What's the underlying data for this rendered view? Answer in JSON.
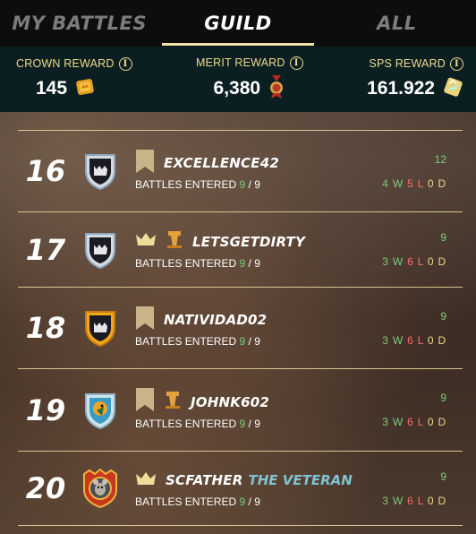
{
  "tabs": [
    {
      "label": "MY BATTLES",
      "active": false
    },
    {
      "label": "GUILD",
      "active": true
    },
    {
      "label": "ALL",
      "active": false
    }
  ],
  "rewards": {
    "crown": {
      "label": "CROWN REWARD",
      "value": "145",
      "icon": "crown-token-icon"
    },
    "merit": {
      "label": "MERIT REWARD",
      "value": "6,380",
      "icon": "merit-medal-icon"
    },
    "sps": {
      "label": "SPS REWARD",
      "value": "161.922",
      "icon": "sps-token-icon"
    }
  },
  "battles_label": "BATTLES ENTERED",
  "rows": [
    {
      "rank": "16",
      "name": "EXCELLENCE42",
      "title": "",
      "entered": "9",
      "total": "9",
      "points": "12",
      "wins": "4",
      "losses": "5",
      "draws": "0",
      "badges": [
        "banner"
      ],
      "avatar": "guild-shield-silver"
    },
    {
      "rank": "17",
      "name": "LETSGETDIRTY",
      "title": "",
      "entered": "9",
      "total": "9",
      "points": "9",
      "wins": "3",
      "losses": "6",
      "draws": "0",
      "badges": [
        "crown",
        "tower"
      ],
      "avatar": "guild-shield-silver"
    },
    {
      "rank": "18",
      "name": "NATIVIDAD02",
      "title": "",
      "entered": "9",
      "total": "9",
      "points": "9",
      "wins": "3",
      "losses": "6",
      "draws": "0",
      "badges": [
        "banner"
      ],
      "avatar": "guild-shield-gold"
    },
    {
      "rank": "19",
      "name": "JOHNK602",
      "title": "",
      "entered": "9",
      "total": "9",
      "points": "9",
      "wins": "3",
      "losses": "6",
      "draws": "0",
      "badges": [
        "banner",
        "tower"
      ],
      "avatar": "player-portrait-parrot"
    },
    {
      "rank": "20",
      "name": "SCFATHER",
      "title": "THE VETERAN",
      "entered": "9",
      "total": "9",
      "points": "9",
      "wins": "3",
      "losses": "6",
      "draws": "0",
      "badges": [
        "crown"
      ],
      "avatar": "player-portrait-rat"
    }
  ],
  "colors": {
    "tab_active_underline": "#efe1a9",
    "gold_text": "#f0d98a",
    "win_green": "#7dcc7a",
    "loss_red": "#ff6a6a",
    "title_blue": "#7fc3d3",
    "reward_bar_bg": "#0b1f22"
  }
}
